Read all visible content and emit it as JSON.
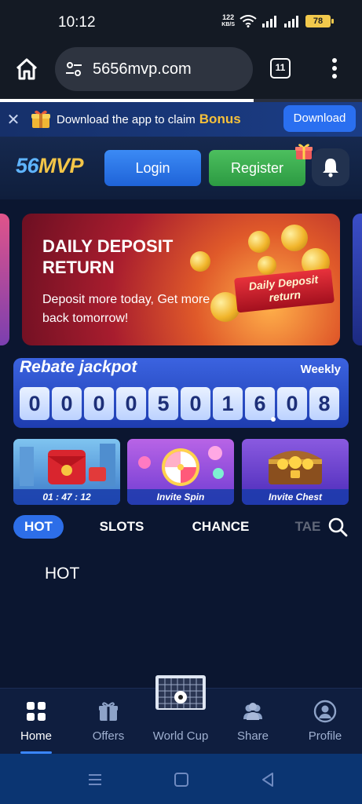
{
  "status_bar": {
    "time": "10:12",
    "net_speed_value": "122",
    "net_speed_unit": "KB/S",
    "battery": "78",
    "icons": [
      "wifi-icon",
      "signal-icon",
      "signal-icon",
      "battery-icon"
    ]
  },
  "browser": {
    "url": "5656mvp.com",
    "tab_count": "11",
    "load_progress": 0.7
  },
  "download_banner": {
    "text": "Download the app to claim",
    "bonus": "Bonus",
    "button": "Download"
  },
  "header": {
    "logo_part1": "56",
    "logo_part2": "MVP",
    "login": "Login",
    "register": "Register"
  },
  "promo": {
    "title": "DAILY DEPOSIT RETURN",
    "subtitle": "Deposit more today, Get more back tomorrow!",
    "ribbon": "Daily Deposit return"
  },
  "jackpot": {
    "title": "Rebate jackpot",
    "period": "Weekly",
    "digits": [
      "0",
      "0",
      "0",
      "0",
      "5",
      "0",
      "1",
      "6",
      "0",
      "8"
    ]
  },
  "cards": [
    {
      "label": "01 : 47 : 12"
    },
    {
      "label": "Invite Spin"
    },
    {
      "label": "Invite Chest"
    }
  ],
  "tabs": [
    {
      "label": "HOT"
    },
    {
      "label": "SLOTS"
    },
    {
      "label": "CHANCE"
    },
    {
      "label": "TAE"
    }
  ],
  "section": {
    "title": "HOT"
  },
  "bottom_nav": [
    {
      "label": "Home",
      "icon": "grid-icon"
    },
    {
      "label": "Offers",
      "icon": "gift-icon"
    },
    {
      "label": "World Cup",
      "icon": "goal-icon"
    },
    {
      "label": "Share",
      "icon": "users-icon"
    },
    {
      "label": "Profile",
      "icon": "profile-icon"
    }
  ],
  "colors": {
    "accent": "#2d6ee8",
    "bonus": "#f6c13b",
    "register": "#3aa84f",
    "background": "#0b1630"
  }
}
